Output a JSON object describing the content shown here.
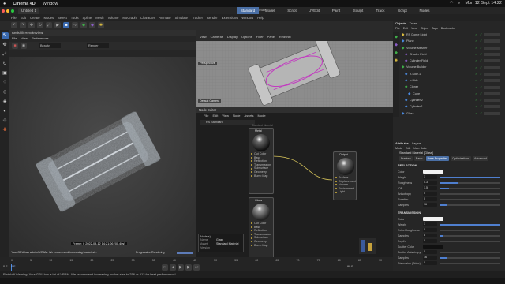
{
  "os": {
    "app": "Cinema 4D",
    "window_menu": "Window",
    "clock": "Mon 12 Sept 14:22"
  },
  "app": {
    "doc_tab": "Untitled 1",
    "title": "Untitled 1 * - Main",
    "layouts": [
      "Standard",
      "Model",
      "Script",
      "UVEdit",
      "Paint",
      "Sculpt",
      "Track",
      "Script",
      "Nodes"
    ],
    "menu": [
      "File",
      "Edit",
      "Create",
      "Modes",
      "Select",
      "Tools",
      "Spline",
      "Mesh",
      "Volume",
      "MoGraph",
      "Character",
      "Animate",
      "Simulate",
      "Tracker",
      "Render",
      "Extensions",
      "Window",
      "Help"
    ]
  },
  "render_view": {
    "title": "Redshift RenderView",
    "menu": [
      "File",
      "View",
      "Preferences"
    ],
    "beauty": "Beauty",
    "renderer": "Render",
    "frame_info": "Frame: 0  2022-09-12 14:21:06  (00.40s)",
    "warn": "Your GPU has a lot of VRAM. We recommend increasing bucket si...",
    "progressive": "Progressive Rendering"
  },
  "viewport": {
    "menu": [
      "View",
      "Cameras",
      "Display",
      "Options",
      "Filter",
      "Panel",
      "Redshift"
    ],
    "label": "Perspective",
    "camera": "Default Camera"
  },
  "node_editor": {
    "title": "Node Editor",
    "menu": [
      "File",
      "Edit",
      "View",
      "Node",
      "Assets",
      "Mode"
    ],
    "preset": "RS Standard",
    "group_label": "Standard Material",
    "nodes": [
      {
        "title": "Metal",
        "ports": [
          "Out Color",
          "Base",
          "Reflection",
          "Transmission",
          "Subsurface",
          "Geometry",
          "Bump Map"
        ]
      },
      {
        "title": "Output",
        "ports": [
          "Surface",
          "Displacement",
          "Volume",
          "Environment",
          "Light"
        ]
      },
      {
        "title": "Glass",
        "ports": [
          "Out Color",
          "Base",
          "Reflection",
          "Transmission",
          "Subsurface",
          "Geometry",
          "Bump Map"
        ]
      }
    ],
    "inspector": {
      "title": "Node(s)",
      "rows": [
        [
          "Name",
          "Glass"
        ],
        [
          "Asset",
          "Standard Material"
        ],
        [
          "Version",
          ""
        ]
      ]
    }
  },
  "objects_panel": {
    "tabs": [
      "Objects",
      "Takes"
    ],
    "menu": [
      "File",
      "Edit",
      "View",
      "Object",
      "Tags",
      "Bookmarks"
    ],
    "items": [
      "RS Dome Light",
      "Plane",
      "Volume Mesher",
      "Shader Field",
      "Cylinder Field",
      "Volume Builder",
      "n-Side.1",
      "n-Side",
      "Cloner",
      "Cube",
      "Cylinder.2",
      "Cylinder.1",
      "Glass"
    ]
  },
  "attributes_panel": {
    "tabs": [
      "Attributes",
      "Layers"
    ],
    "menu": [
      "Mode",
      "Edit",
      "User Data"
    ],
    "header": "Standard Material [Glass]",
    "subtabs": [
      "Preview",
      "Basic",
      "Base Properties",
      "Optimizations",
      "Advanced"
    ],
    "sections": [
      {
        "title": "REFLECTION",
        "rows": [
          {
            "label": "Color",
            "value": "",
            "level": 0
          },
          {
            "label": "Weight",
            "value": "1",
            "level": 1
          },
          {
            "label": "Roughness",
            "value": "0.3",
            "level": 0.3
          },
          {
            "label": "IOR",
            "value": "1.5",
            "level": 0.15
          },
          {
            "label": "Anisotropy",
            "value": "0",
            "level": 0
          },
          {
            "label": "Rotation",
            "value": "0",
            "level": 0
          },
          {
            "label": "Samples",
            "value": "16",
            "level": 0.1
          }
        ]
      },
      {
        "title": "TRANSMISSION",
        "rows": [
          {
            "label": "Color",
            "value": "",
            "level": 0
          },
          {
            "label": "Weight",
            "value": "1",
            "level": 1
          },
          {
            "label": "Extra Roughness",
            "value": "0",
            "level": 0
          },
          {
            "label": "Samples",
            "value": "8",
            "level": 0.05
          },
          {
            "label": "Depth",
            "value": "0",
            "level": 0
          },
          {
            "label": "Scatter Color",
            "value": "",
            "level": 0
          },
          {
            "label": "Scatter Anisotropy",
            "value": "0",
            "level": 0
          },
          {
            "label": "Samples",
            "value": "16",
            "level": 0.1
          },
          {
            "label": "Dispersion (Abbe)",
            "value": "0",
            "level": 0
          }
        ]
      }
    ]
  },
  "timeline": {
    "start": "0 F",
    "end": "90 F",
    "current": "0 F",
    "ticks": [
      "0",
      "5",
      "10",
      "15",
      "20",
      "25",
      "30",
      "35",
      "40",
      "45",
      "50",
      "55",
      "60",
      "65",
      "70",
      "75",
      "80",
      "85",
      "90"
    ]
  },
  "status": {
    "message": "Redshift Warning: Your GPU has a lot of VRAM. We recommend increasing bucket size to 256 or 512 for best performance!"
  },
  "colors": {
    "accent": "#4a6fa5",
    "node_title_metal": "#d7b63b",
    "wire": "#d8c55a",
    "check": "#3fae49"
  }
}
